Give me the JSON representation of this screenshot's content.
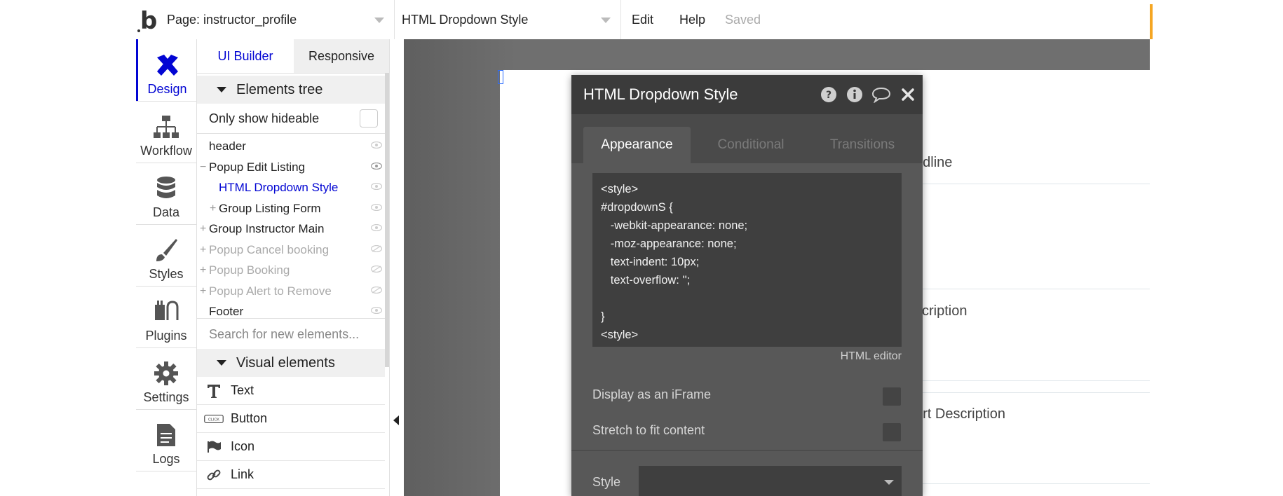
{
  "topbar": {
    "logo": "b",
    "page_select": "Page: instructor_profile",
    "element_select": "HTML Dropdown Style",
    "menu_edit": "Edit",
    "menu_help": "Help",
    "status": "Saved"
  },
  "leftnav": {
    "design": "Design",
    "workflow": "Workflow",
    "data": "Data",
    "styles": "Styles",
    "plugins": "Plugins",
    "settings": "Settings",
    "logs": "Logs"
  },
  "panel": {
    "tab_ui_builder": "UI Builder",
    "tab_responsive": "Responsive",
    "elements_tree": "Elements tree",
    "only_show_hideable": "Only show hideable",
    "tree": [
      {
        "label": "header"
      },
      {
        "label": "Popup Edit Listing"
      },
      {
        "label": "HTML Dropdown Style"
      },
      {
        "label": "Group Listing Form"
      },
      {
        "label": "Group Instructor Main"
      },
      {
        "label": "Popup Cancel booking"
      },
      {
        "label": "Popup Booking"
      },
      {
        "label": "Popup Alert to Remove"
      },
      {
        "label": "Footer"
      }
    ],
    "search_placeholder": "Search for new elements...",
    "visual_elements": "Visual elements",
    "visual": [
      {
        "label": "Text",
        "icon": "text-icon"
      },
      {
        "label": "Button",
        "icon": "button-icon",
        "badge": "CLICK"
      },
      {
        "label": "Icon",
        "icon": "flag-icon"
      },
      {
        "label": "Link",
        "icon": "link-icon"
      }
    ]
  },
  "canvas": {
    "label_headline": "adline",
    "label_description": "scription",
    "label_short_description": "ort Description"
  },
  "modal": {
    "title": "HTML Dropdown Style",
    "tab_appearance": "Appearance",
    "tab_conditional": "Conditional",
    "tab_transitions": "Transitions",
    "code": "<style>\n#dropdownS {\n   -webkit-appearance: none;\n   -moz-appearance: none;\n   text-indent: 10px;\n   text-overflow: '';\n\n}\n<style>",
    "html_editor": "HTML editor",
    "display_iframe": "Display as an iFrame",
    "stretch_fit": "Stretch to fit content",
    "style_label": "Style"
  },
  "colors": {
    "accent_blue": "#0205d3",
    "accent_orange": "#f5a623"
  }
}
